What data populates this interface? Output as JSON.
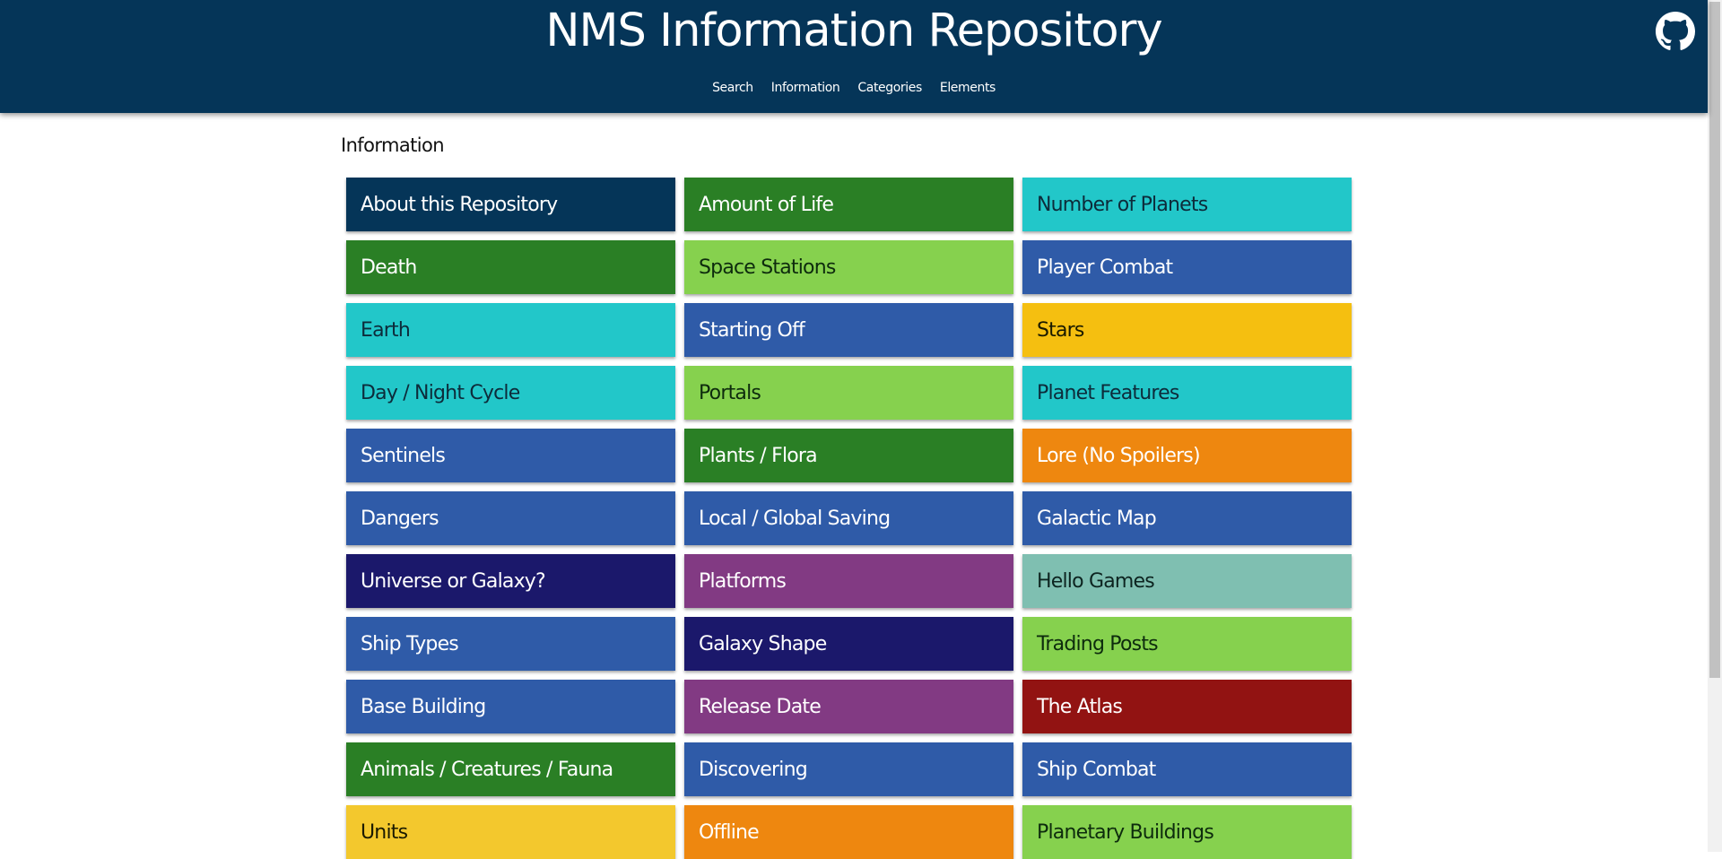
{
  "header": {
    "title": "NMS Information Repository",
    "nav": [
      "Search",
      "Information",
      "Categories",
      "Elements"
    ],
    "background": "#053558",
    "github_icon": "github-icon"
  },
  "main": {
    "heading": "Information",
    "tiles": [
      {
        "label": "About this Repository",
        "bg": "#053558",
        "color": "#ffffff"
      },
      {
        "label": "Amount of Life",
        "bg": "#2a7f25",
        "color": "#ffffff"
      },
      {
        "label": "Number of Planets",
        "bg": "#22c7c9",
        "color": "#0d2b3a"
      },
      {
        "label": "Death",
        "bg": "#2a7f25",
        "color": "#ffffff"
      },
      {
        "label": "Space Stations",
        "bg": "#86d14e",
        "color": "#0d2b0d"
      },
      {
        "label": "Player Combat",
        "bg": "#2f5ba8",
        "color": "#ffffff"
      },
      {
        "label": "Earth",
        "bg": "#22c7c9",
        "color": "#0d2b3a"
      },
      {
        "label": "Starting Off",
        "bg": "#2f5ba8",
        "color": "#ffffff"
      },
      {
        "label": "Stars",
        "bg": "#f5bf10",
        "color": "#1a1a00"
      },
      {
        "label": "Day / Night Cycle",
        "bg": "#22c7c9",
        "color": "#0d2b3a"
      },
      {
        "label": "Portals",
        "bg": "#86d14e",
        "color": "#0d2b0d"
      },
      {
        "label": "Planet Features",
        "bg": "#22c7c9",
        "color": "#0d2b3a"
      },
      {
        "label": "Sentinels",
        "bg": "#2f5ba8",
        "color": "#ffffff"
      },
      {
        "label": "Plants / Flora",
        "bg": "#2a7f25",
        "color": "#ffffff"
      },
      {
        "label": "Lore (No Spoilers)",
        "bg": "#ee870f",
        "color": "#ffffff"
      },
      {
        "label": "Dangers",
        "bg": "#2f5ba8",
        "color": "#ffffff"
      },
      {
        "label": "Local / Global Saving",
        "bg": "#2f5ba8",
        "color": "#ffffff"
      },
      {
        "label": "Galactic Map",
        "bg": "#2f5ba8",
        "color": "#ffffff"
      },
      {
        "label": "Universe or Galaxy?",
        "bg": "#1b186b",
        "color": "#ffffff"
      },
      {
        "label": "Platforms",
        "bg": "#823a83",
        "color": "#ffffff"
      },
      {
        "label": "Hello Games",
        "bg": "#7fbfb1",
        "color": "#0d2420"
      },
      {
        "label": "Ship Types",
        "bg": "#2f5ba8",
        "color": "#ffffff"
      },
      {
        "label": "Galaxy Shape",
        "bg": "#1b186b",
        "color": "#ffffff"
      },
      {
        "label": "Trading Posts",
        "bg": "#86d14e",
        "color": "#0d2b0d"
      },
      {
        "label": "Base Building",
        "bg": "#2f5ba8",
        "color": "#ffffff"
      },
      {
        "label": "Release Date",
        "bg": "#823a83",
        "color": "#ffffff"
      },
      {
        "label": "The Atlas",
        "bg": "#921312",
        "color": "#ffffff"
      },
      {
        "label": "Animals / Creatures / Fauna",
        "bg": "#2a7f25",
        "color": "#ffffff"
      },
      {
        "label": "Discovering",
        "bg": "#2f5ba8",
        "color": "#ffffff"
      },
      {
        "label": "Ship Combat",
        "bg": "#2f5ba8",
        "color": "#ffffff"
      },
      {
        "label": "Units",
        "bg": "#f3c82d",
        "color": "#1a1a00"
      },
      {
        "label": "Offline",
        "bg": "#ee870f",
        "color": "#ffffff"
      },
      {
        "label": "Planetary Buildings",
        "bg": "#86d14e",
        "color": "#0d2b0d"
      }
    ]
  }
}
